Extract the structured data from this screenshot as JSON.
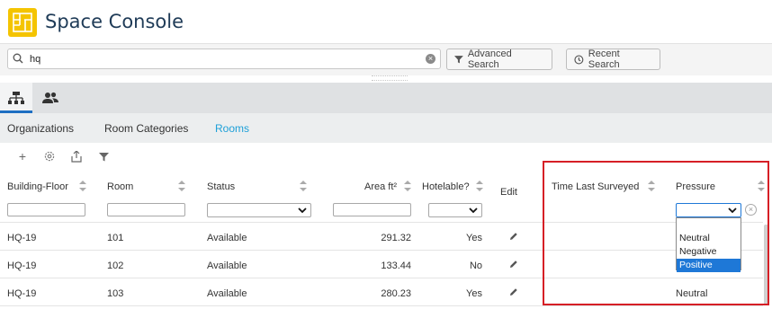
{
  "app": {
    "title": "Space Console",
    "accent": "#1ea0d8",
    "logo_color": "#f4c400"
  },
  "search": {
    "value": "hq",
    "advanced_label": "Advanced Search",
    "recent_label": "Recent Search"
  },
  "tabs": {
    "icons": [
      "hierarchy-icon",
      "people-icon"
    ]
  },
  "subnav": {
    "items": [
      "Organizations",
      "Room Categories",
      "Rooms"
    ],
    "active": "Rooms"
  },
  "toolbar": {
    "icons": [
      "add-icon",
      "settings-icon",
      "export-icon",
      "filter-icon"
    ],
    "add_glyph": "+"
  },
  "table": {
    "columns": [
      "Building-Floor",
      "Room",
      "Status",
      "Area ft²",
      "Hotelable?",
      "Edit",
      "Time Last Surveyed",
      "Pressure"
    ],
    "rows": [
      {
        "building_floor": "HQ-19",
        "room": "101",
        "status": "Available",
        "area": "291.32",
        "hotelable": "Yes",
        "pressure": ""
      },
      {
        "building_floor": "HQ-19",
        "room": "102",
        "status": "Available",
        "area": "133.44",
        "hotelable": "No",
        "pressure": ""
      },
      {
        "building_floor": "HQ-19",
        "room": "103",
        "status": "Available",
        "area": "280.23",
        "hotelable": "Yes",
        "pressure": "Neutral"
      }
    ]
  },
  "pressure_dropdown": {
    "options": [
      "",
      "Neutral",
      "Negative",
      "Positive"
    ],
    "highlighted": "Positive"
  },
  "highlight_color": "#d61f26"
}
